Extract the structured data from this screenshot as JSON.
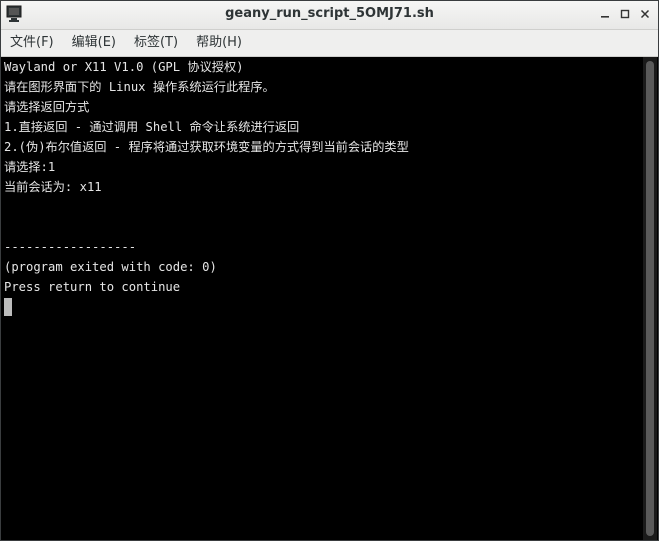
{
  "window": {
    "title": "geany_run_script_5OMJ71.sh"
  },
  "menubar": {
    "items": [
      {
        "label": "文件(F)"
      },
      {
        "label": "编辑(E)"
      },
      {
        "label": "标签(T)"
      },
      {
        "label": "帮助(H)"
      }
    ]
  },
  "terminal": {
    "lines": [
      "Wayland or X11 V1.0 (GPL 协议授权)",
      "请在图形界面下的 Linux 操作系统运行此程序。",
      "请选择返回方式",
      "1.直接返回 - 通过调用 Shell 命令让系统进行返回",
      "2.(伪)布尔值返回 - 程序将通过获取环境变量的方式得到当前会话的类型",
      "请选择:1",
      "当前会话为: x11",
      "",
      "",
      "------------------",
      "(program exited with code: 0)",
      "Press return to continue"
    ]
  },
  "colors": {
    "terminal_bg": "#000000",
    "terminal_fg": "#e6e6e6",
    "titlebar_bg": "#f2f2f1"
  },
  "icons": [
    "terminal-app-icon",
    "minimize-icon",
    "maximize-icon",
    "close-icon"
  ]
}
